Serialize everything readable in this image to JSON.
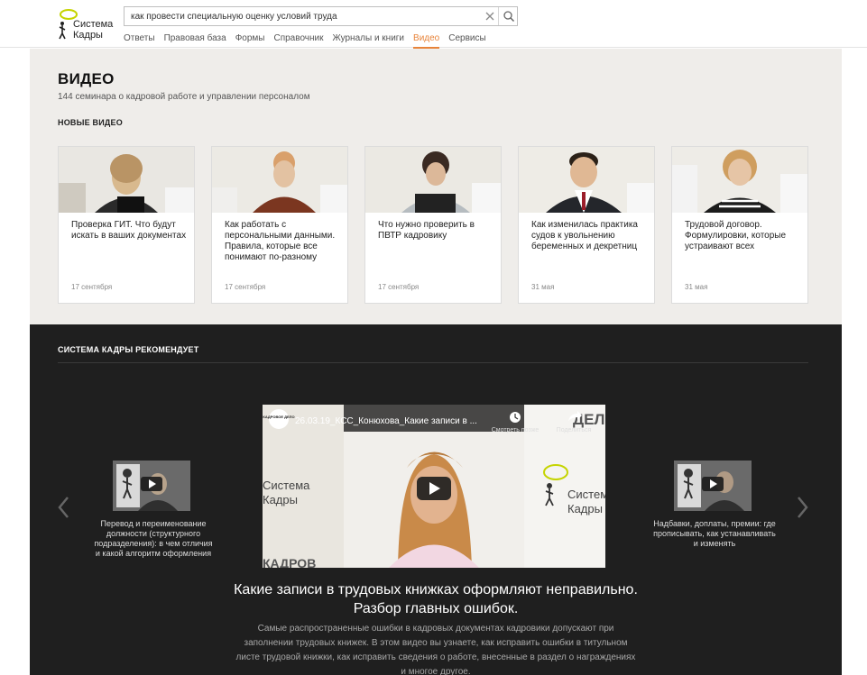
{
  "header": {
    "logo_line1": "Система",
    "logo_line2": "Кадры",
    "search": {
      "value": "как провести специальную оценку условий труда"
    },
    "nav": [
      {
        "label": "Ответы"
      },
      {
        "label": "Правовая база"
      },
      {
        "label": "Формы"
      },
      {
        "label": "Справочник"
      },
      {
        "label": "Журналы и книги"
      },
      {
        "label": "Видео",
        "active": true
      },
      {
        "label": "Сервисы"
      }
    ]
  },
  "video_page": {
    "title": "ВИДЕО",
    "subtitle": "144 семинара о кадровой работе и управлении персоналом",
    "new_videos_label": "НОВЫЕ ВИДЕО",
    "cards": [
      {
        "title": "Проверка ГИТ. Что будут искать в ваших документах",
        "date": "17 сентября"
      },
      {
        "title": "Как работать с персональными данными. Правила, которые все понимают по-разному",
        "date": "17 сентября"
      },
      {
        "title": "Что нужно проверить в ПВТР кадровику",
        "date": "17 сентября"
      },
      {
        "title": "Как изменилась практика судов к увольнению беременных и декретниц",
        "date": "31 мая"
      },
      {
        "title": "Трудовой договор. Формулировки, которые устраивают всех",
        "date": "31 мая"
      }
    ]
  },
  "recommend": {
    "label": "СИСТЕМА КАДРЫ РЕКОМЕНДУЕТ",
    "left_video": {
      "title": "Перевод и переименование должности (структурного подразделения): в чем отличия и какой алгоритм оформления"
    },
    "right_video": {
      "title": "Надбавки, доплаты, премии: где прописывать, как устанавливать и изменять"
    },
    "player": {
      "channel": "КАДРОВОЕ ДЕЛО",
      "video_title": "26.03.19_КСС_Конюхова_Какие записи в ...",
      "watch_later": "Смотреть позже",
      "share": "Поделиться",
      "brand_line1": "Система",
      "brand_line2": "Кадры",
      "backdrop_bottom": "КАДРОВ",
      "backdrop_top": "ДЕЛ"
    },
    "main_title": "Какие записи в трудовых книжках оформляют неправильно. Разбор главных ошибок.",
    "main_desc": "Самые распространенные ошибки в кадровых документах кадровики допускают при заполнении трудовых книжек. В этом видео вы узнаете, как исправить ошибки в титульном листе трудовой книжки, как исправить сведения о работе, внесенные в раздел о награждениях и многое другое."
  }
}
